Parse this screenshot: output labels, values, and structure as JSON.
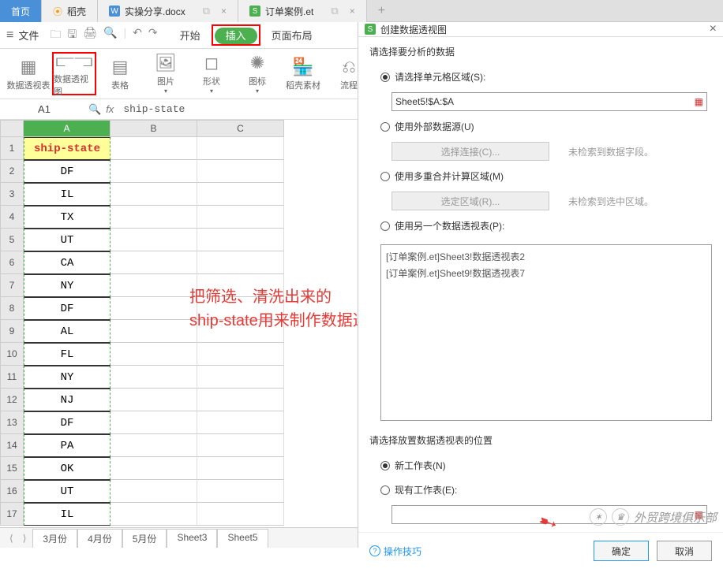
{
  "tabs": {
    "home": "首页",
    "daoke": "稻壳",
    "doc": "实操分享.docx",
    "et": "订单案例.et",
    "plus": "+"
  },
  "menu": {
    "file": "文件",
    "start": "开始",
    "insert": "插入",
    "layout": "页面布局"
  },
  "ribbon": {
    "pivot_table": "数据透视表",
    "pivot_chart": "数据透视图",
    "table": "表格",
    "picture": "图片",
    "shape": "形状",
    "icon": "图标",
    "daoke_material": "稻壳素材",
    "flowchart": "流程"
  },
  "cellbar": {
    "ref": "A1",
    "value": "ship-state"
  },
  "columns": [
    "A",
    "B",
    "C"
  ],
  "rowdata": [
    "ship-state",
    "DF",
    "IL",
    "TX",
    "UT",
    "CA",
    "NY",
    "DF",
    "AL",
    "FL",
    "NY",
    "NJ",
    "DF",
    "PA",
    "OK",
    "UT",
    "IL"
  ],
  "annotation": "把筛选、清洗出来的\nship-state用来制作数据透视图",
  "sheet_tabs": {
    "nav": "⟨ ⟩",
    "tabs": [
      "3月份",
      "4月份",
      "5月份",
      "Sheet3",
      "Sheet5"
    ]
  },
  "dialog": {
    "title": "创建数据透视图",
    "section1": "请选择要分析的数据",
    "radio_cell_range": "请选择单元格区域(S):",
    "range_value": "Sheet5!$A:$A",
    "radio_external": "使用外部数据源(U)",
    "btn_choose_conn": "选择连接(C)...",
    "hint_no_conn": "未检索到数据字段。",
    "radio_multi": "使用多重合并计算区域(M)",
    "btn_select_range": "选定区域(R)...",
    "hint_no_range": "未检索到选中区域。",
    "radio_another": "使用另一个数据透视表(P):",
    "pivot_list": [
      "[订单案例.et]Sheet3!数据透视表2",
      "[订单案例.et]Sheet9!数据透视表7"
    ],
    "section2": "请选择放置数据透视表的位置",
    "radio_new_sheet": "新工作表(N)",
    "radio_existing": "现有工作表(E):",
    "help": "操作技巧",
    "ok": "确定",
    "cancel": "取消"
  },
  "watermark": "外贸跨境俱乐部"
}
